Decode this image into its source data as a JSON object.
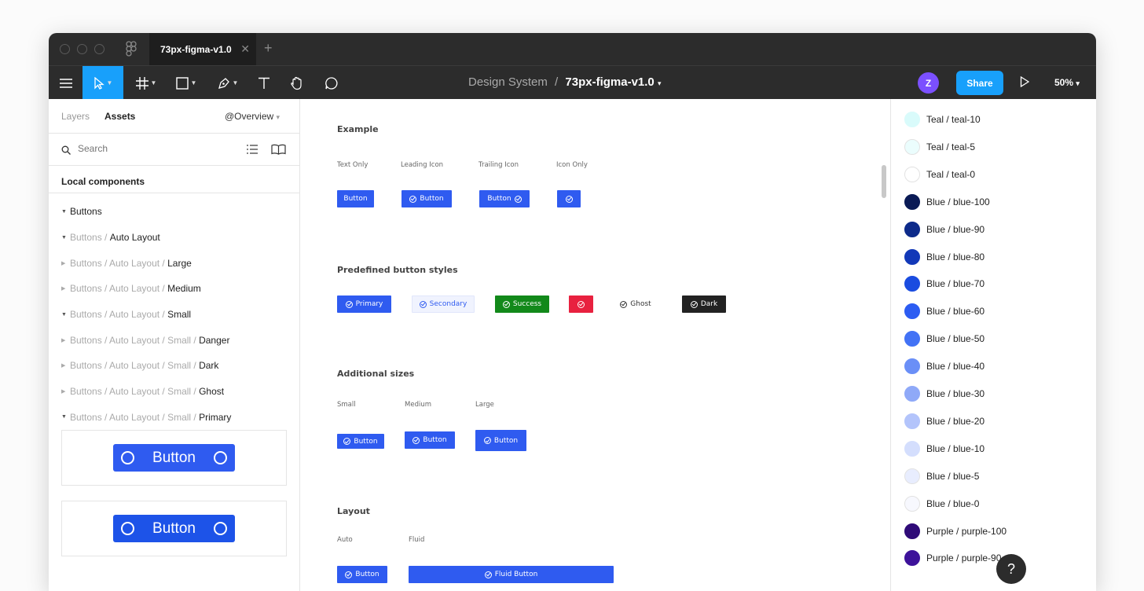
{
  "tab": {
    "title": "73px-figma-v1.0",
    "close": "✕",
    "new": "+"
  },
  "toolbar": {
    "breadcrumb_project": "Design System",
    "breadcrumb_sep": "/",
    "breadcrumb_file": "73px-figma-v1.0",
    "avatar": "Z",
    "share_label": "Share",
    "zoom": "50%"
  },
  "left_panel": {
    "tab_layers": "Layers",
    "tab_assets": "Assets",
    "page_select": "@Overview",
    "search_placeholder": "Search",
    "section_title": "Local components",
    "tree": [
      {
        "dim": "",
        "last": "Buttons",
        "open": true
      },
      {
        "dim": "Buttons / ",
        "last": "Auto Layout",
        "open": true
      },
      {
        "dim": "Buttons / Auto Layout / ",
        "last": "Large",
        "open": false
      },
      {
        "dim": "Buttons / Auto Layout / ",
        "last": "Medium",
        "open": false
      },
      {
        "dim": "Buttons / Auto Layout / ",
        "last": "Small",
        "open": true
      },
      {
        "dim": "Buttons / Auto Layout / Small / ",
        "last": "Danger",
        "open": false
      },
      {
        "dim": "Buttons / Auto Layout / Small / ",
        "last": "Dark",
        "open": false
      },
      {
        "dim": "Buttons / Auto Layout / Small / ",
        "last": "Ghost",
        "open": false
      },
      {
        "dim": "Buttons / Auto Layout / Small / ",
        "last": "Primary",
        "open": true
      }
    ],
    "preview_button_1": "Button",
    "preview_button_2": "Button"
  },
  "canvas": {
    "example_title": "Example",
    "example_labels": [
      "Text Only",
      "Leading Icon",
      "Trailing Icon",
      "Icon Only"
    ],
    "example_buttons": [
      "Button",
      "Button",
      "Button"
    ],
    "predefined_title": "Predefined button styles",
    "predefined_buttons": [
      "Primary",
      "Secondary",
      "Success",
      "Ghost",
      "Dark"
    ],
    "sizes_title": "Additional sizes",
    "sizes_labels": [
      "Small",
      "Medium",
      "Large"
    ],
    "sizes_buttons": [
      "Button",
      "Button",
      "Button"
    ],
    "layout_title": "Layout",
    "layout_labels": [
      "Auto",
      "Fluid"
    ],
    "layout_buttons": [
      "Button",
      "Fluid Button"
    ]
  },
  "colors": [
    {
      "name": "Teal / teal-10",
      "hex": "#d9fbfb"
    },
    {
      "name": "Teal / teal-5",
      "hex": "#ebfdfd"
    },
    {
      "name": "Teal / teal-0",
      "hex": "#ffffff"
    },
    {
      "name": "Blue / blue-100",
      "hex": "#0a1a55"
    },
    {
      "name": "Blue / blue-90",
      "hex": "#0d2a8a"
    },
    {
      "name": "Blue / blue-80",
      "hex": "#1238b8"
    },
    {
      "name": "Blue / blue-70",
      "hex": "#1a4ce0"
    },
    {
      "name": "Blue / blue-60",
      "hex": "#2c5cf2"
    },
    {
      "name": "Blue / blue-50",
      "hex": "#4272f5"
    },
    {
      "name": "Blue / blue-40",
      "hex": "#6a8ff7"
    },
    {
      "name": "Blue / blue-30",
      "hex": "#8fa9f8"
    },
    {
      "name": "Blue / blue-20",
      "hex": "#b3c4fb"
    },
    {
      "name": "Blue / blue-10",
      "hex": "#d4defd"
    },
    {
      "name": "Blue / blue-5",
      "hex": "#e8edfe"
    },
    {
      "name": "Blue / blue-0",
      "hex": "#f7f8fe"
    },
    {
      "name": "Purple / purple-100",
      "hex": "#2f0b78"
    },
    {
      "name": "Purple / purple-90",
      "hex": "#3d129a"
    }
  ],
  "help": "?"
}
